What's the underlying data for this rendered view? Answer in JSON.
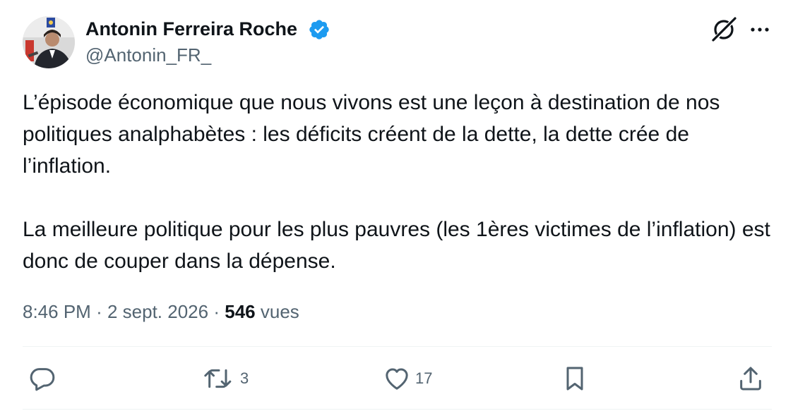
{
  "author": {
    "display_name": "Antonin Ferreira Roche",
    "handle": "@Antonin_FR_",
    "verified": true
  },
  "tweet": {
    "paragraphs": [
      "L’épisode économique que nous vivons est une leçon à destination de nos politiques analphabètes : les déficits créent de la dette, la dette crée de l’inflation.",
      "La meilleure politique pour les plus pauvres (les 1ères victimes de l’inflation) est donc de couper dans la dépense."
    ],
    "time": "8:46 PM",
    "separator": "·",
    "date": "2 sept. 2026",
    "views_count": "546",
    "views_label": "vues"
  },
  "actions": {
    "reply_count": "",
    "retweet_count": "3",
    "like_count": "17"
  },
  "colors": {
    "text_primary": "#0f1419",
    "text_secondary": "#536471",
    "verified_blue": "#1d9bf0",
    "divider": "#eff3f4"
  },
  "icons": {
    "header": [
      "grok-icon",
      "more-icon"
    ],
    "actions": [
      "reply-icon",
      "retweet-icon",
      "like-icon",
      "bookmark-icon",
      "share-icon"
    ]
  }
}
